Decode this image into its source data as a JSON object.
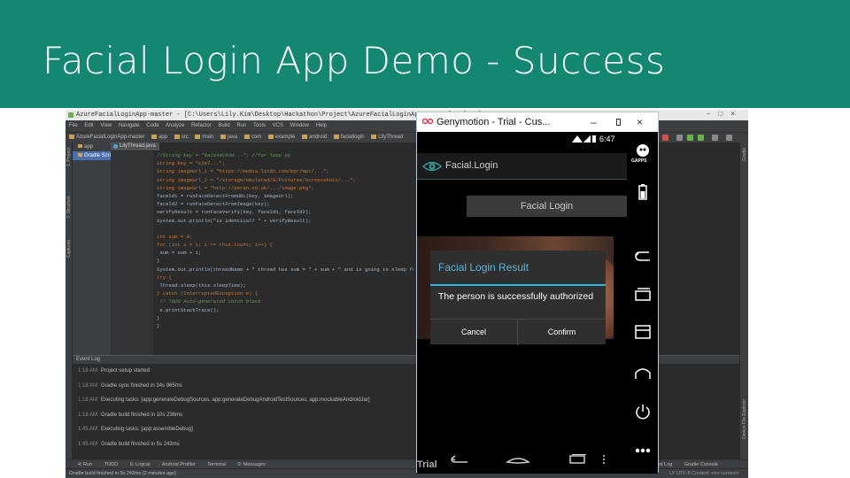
{
  "slide": {
    "title": "Facial Login App Demo - Success"
  },
  "colors": {
    "slide_header": "#13876f",
    "ide_bg": "#2b2b2b",
    "dialog_title": "#5fb3d6",
    "dialog_rule": "#33b5e5"
  },
  "ide": {
    "window_title": "AzureFacialLoginApp-master - [C:\\Users\\Lily.Kim\\Desktop\\Hackathon\\Project\\AzureFacialLoginApp-master] - [app] - ...",
    "menu": [
      "File",
      "Edit",
      "View",
      "Navigate",
      "Code",
      "Analyze",
      "Refactor",
      "Build",
      "Run",
      "Tools",
      "VCS",
      "Window",
      "Help"
    ],
    "breadcrumbs": [
      "AzureFacialLoginApp-master",
      "app",
      "src",
      "main",
      "java",
      "com",
      "example",
      "android",
      "faciallogin",
      "LilyThread"
    ],
    "project_tree": [
      "app",
      "Gradle Scripts"
    ],
    "editor_tab": "LilyThread.java",
    "code_lines": [
      {
        "no": "225",
        "text": "//String key = \"0a2a49c0dd...\"; //for loop up"
      },
      {
        "no": "226",
        "text": "String key = \"c2e7...\";"
      },
      {
        "no": "227",
        "text": "String imageUrl_1 = \"https://media.licdn.com/mpr/mpr/...\";"
      },
      {
        "no": "228",
        "text": "String imageUrl_2 = \"/storage/emulated/0/Pictures/Screenshots/...\";"
      },
      {
        "no": "229",
        "text": "String imageUrl = \"http://pecan.co.uk/.../image.png\";"
      },
      {
        "no": "230",
        "text": "faceId1 = runFaceDetectFromURL(key, imageUrl);"
      },
      {
        "no": "231",
        "text": "faceId2 = runFaceDetectFromImage(key);"
      },
      {
        "no": "232",
        "text": "verifyResult = runFaceVerify(key, faceId1, faceId2);"
      },
      {
        "no": "233",
        "text": "System.out.println(\"is identical? \" + verifyResult);"
      },
      {
        "no": "234",
        "text": ""
      },
      {
        "no": "235",
        "text": "int sum = 0;"
      },
      {
        "no": "236",
        "text": "for (int i = 1; i <= this.count; i++) {"
      },
      {
        "no": "237",
        "text": "    sum = sum + i;"
      },
      {
        "no": "238",
        "text": "}"
      },
      {
        "no": "239",
        "text": "System.out.println(threadName + \" thread has sum = \" + sum + \" and is going to sleep for \" + ..."
      },
      {
        "no": "240",
        "text": "try {"
      },
      {
        "no": "241",
        "text": "    Thread.sleep(this.sleepTime);"
      },
      {
        "no": "242",
        "text": "} catch (InterruptedException e) {"
      },
      {
        "no": "243",
        "text": "    // TODO Auto-generated catch block"
      },
      {
        "no": "244",
        "text": "    e.printStackTrace();"
      },
      {
        "no": "245",
        "text": "}"
      },
      {
        "no": "246",
        "text": "}"
      }
    ],
    "event_log_title": "Event Log",
    "event_log": [
      {
        "time": "1:18 AM",
        "msg": "Project setup started"
      },
      {
        "time": "1:18 AM",
        "msg": "Gradle sync finished in 34s 965ms"
      },
      {
        "time": "1:18 AM",
        "msg": "Executing tasks: [app:generateDebugSources, app:generateDebugAndroidTestSources, app:mockableAndroidJar]"
      },
      {
        "time": "1:18 AM",
        "msg": "Gradle build finished in 10s 236ms"
      },
      {
        "time": "1:45 AM",
        "msg": "Executing tasks: [app:assembleDebug]"
      },
      {
        "time": "1:45 AM",
        "msg": "Gradle build finished in 5s 243ms"
      }
    ],
    "tool_tabs": [
      "4: Run",
      "TODO",
      "6: Logcat",
      "Android Profiler",
      "Terminal",
      "0: Messages"
    ],
    "tool_tabs_right": [
      "Event Log",
      "Gradle Console"
    ],
    "status": "Gradle build finished in 5s 243ms (2 minutes ago)",
    "status_right": "LF  UTF-8  Context: <no context>",
    "left_vtabs": [
      "1: Project",
      "7: Structure",
      "Captures"
    ],
    "right_vtabs": [
      "Gradle",
      "Device File Explorer"
    ]
  },
  "emulator": {
    "window_title": "Genymotion - Trial - Cus...",
    "time": "6:47",
    "gapps_label": "GAPPS",
    "app_title": "Facial.Login",
    "screen_button": "Facial Login",
    "dialog": {
      "title": "Facial Login Result",
      "message": "The person is successfully authorized",
      "cancel": "Cancel",
      "confirm": "Confirm"
    },
    "watermark": "Trial"
  }
}
